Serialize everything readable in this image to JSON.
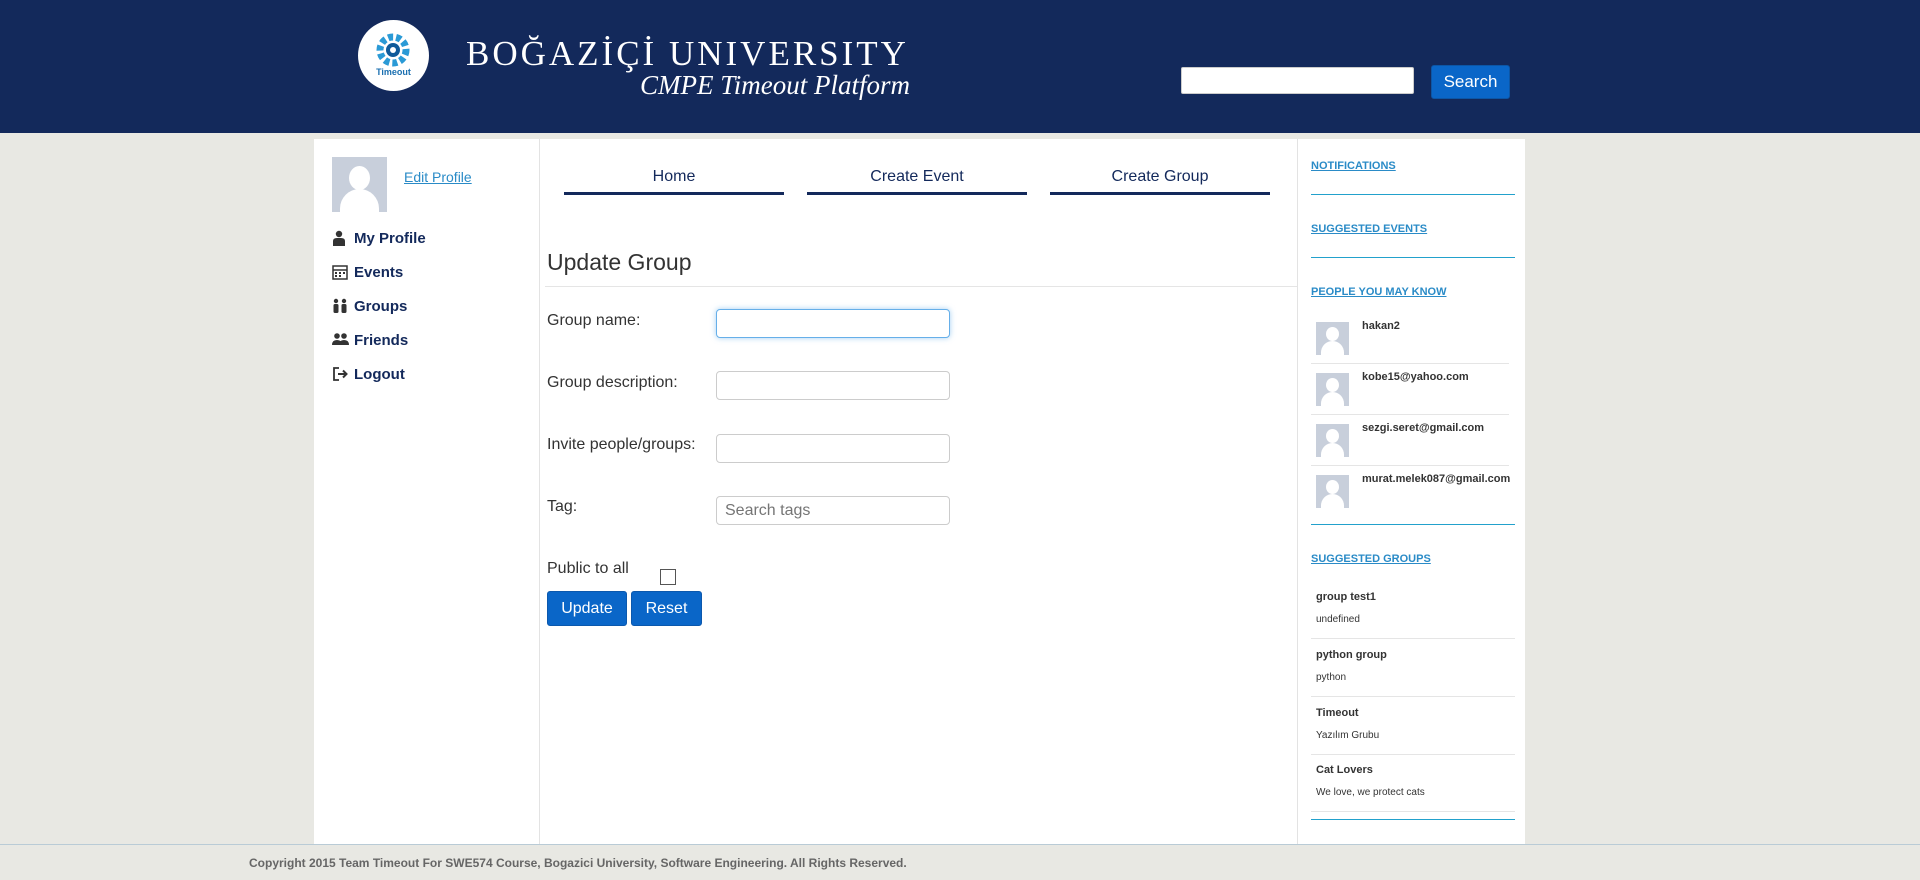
{
  "header": {
    "logo_text": "Timeout",
    "title": "BOĞAZİÇİ UNIVERSITY",
    "subtitle": "CMPE Timeout Platform",
    "search_value": "",
    "search_button": "Search",
    "background_color": "#13295b",
    "accent_color": "#0a66c8"
  },
  "left_sidebar": {
    "edit_profile": "Edit Profile",
    "nav_items": [
      {
        "label": "My Profile",
        "icon": "user-icon"
      },
      {
        "label": "Events",
        "icon": "calendar-icon"
      },
      {
        "label": "Groups",
        "icon": "group-icon"
      },
      {
        "label": "Friends",
        "icon": "friends-icon"
      },
      {
        "label": "Logout",
        "icon": "logout-icon"
      }
    ]
  },
  "top_nav": {
    "tabs": [
      "Home",
      "Create Event",
      "Create Group"
    ]
  },
  "form": {
    "title": "Update Group",
    "group_name_label": "Group name:",
    "group_name_value": "",
    "group_description_label": "Group description:",
    "group_description_value": "",
    "invite_label": "Invite people/groups:",
    "invite_value": "",
    "tag_label": "Tag:",
    "tag_placeholder": "Search tags",
    "public_label": "Public to all",
    "public_checked": false,
    "update_button": "Update",
    "reset_button": "Reset"
  },
  "right_sidebar": {
    "notifications_heading": "NOTIFICATIONS",
    "suggested_events_heading": "SUGGESTED EVENTS",
    "people_heading": "PEOPLE YOU MAY KNOW",
    "people": [
      "hakan2",
      "kobe15@yahoo.com",
      "sezgi.seret@gmail.com",
      "murat.melek087@gmail.com"
    ],
    "suggested_groups_heading": "SUGGESTED GROUPS",
    "groups": [
      {
        "name": "group test1",
        "description": "undefined"
      },
      {
        "name": "python group",
        "description": "python"
      },
      {
        "name": "Timeout",
        "description": "Yazılım Grubu"
      },
      {
        "name": "Cat Lovers",
        "description": "We love, we protect cats"
      }
    ]
  },
  "footer": {
    "copyright": "Copyright 2015 Team Timeout For SWE574 Course, Bogazici University, Software Engineering. All Rights Reserved."
  }
}
